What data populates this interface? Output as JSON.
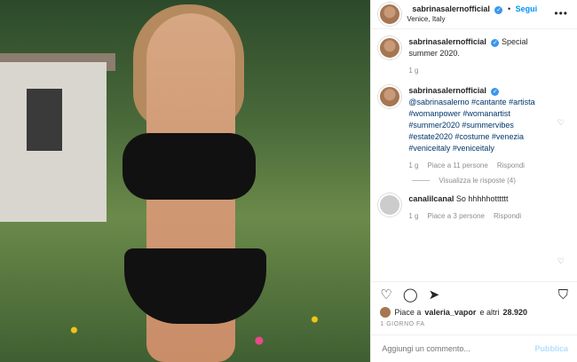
{
  "header": {
    "username": "sabrinasalernofficial",
    "follow_label": "Segui",
    "location": "Venice, Italy",
    "dot": "•"
  },
  "caption": {
    "username": "sabrinasalernofficial",
    "text": "Special summer 2020.",
    "time": "1 g"
  },
  "comments": [
    {
      "username": "sabrinasalernofficial",
      "text": "@sabrinasalerno #cantante #artista #womanpower #womanartist #summer2020 #summervibes #estate2020 #costume #venezia #veniceitaly #veniceitaly",
      "time": "1 g",
      "likes": "Piace a 11 persone",
      "reply": "Rispondi",
      "view_replies": "Visualizza le risposte (4)"
    },
    {
      "username": "canalilcanal",
      "text": "So hhhhhotttttt",
      "time": "1 g",
      "likes": "Piace a 3 persone",
      "reply": "Rispondi"
    }
  ],
  "likes_summary": {
    "prefix": "Piace a",
    "user": "valeria_vapor",
    "suffix": "e altri",
    "count": "28.920"
  },
  "timestamp": "1 GIORNO FA",
  "add_comment": {
    "placeholder": "Aggiungi un commento...",
    "publish_label": "Pubblica"
  },
  "icons": {
    "like": "heart-icon",
    "comment": "comment-icon",
    "share": "share-icon",
    "save": "bookmark-icon",
    "more": "more-icon"
  },
  "colors": {
    "accent": "#0095f6",
    "verified": "#3897f0",
    "muted": "#8e8e8e"
  }
}
